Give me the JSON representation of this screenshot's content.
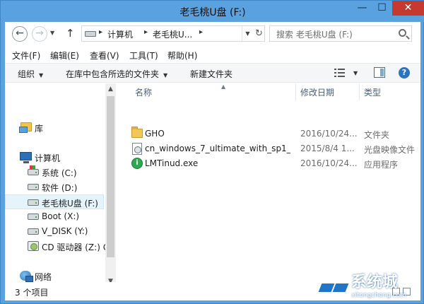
{
  "window": {
    "title": "老毛桃U盘 (F:)",
    "controls": {
      "minimize": "—",
      "maximize": "☐",
      "close": "✕"
    }
  },
  "address": {
    "back": "←",
    "forward": "→",
    "up": "↑",
    "segments": [
      "计算机",
      "老毛桃U..."
    ],
    "refresh": "↻",
    "search_placeholder": "搜索 老毛桃U盘 (F:)"
  },
  "menu": [
    "文件(F)",
    "编辑(E)",
    "查看(V)",
    "工具(T)",
    "帮助(H)"
  ],
  "toolbar": {
    "organize": "组织",
    "include_in_library": "在库中包含所选的文件夹",
    "new_folder": "新建文件夹",
    "help": "?"
  },
  "nav": {
    "library": "库",
    "computer": "计算机",
    "drives": [
      {
        "label": "系统 (C:)",
        "icon": "system-drive-icon"
      },
      {
        "label": "软件 (D:)",
        "icon": "drive-icon"
      },
      {
        "label": "老毛桃U盘 (F:)",
        "icon": "usb-drive-icon",
        "selected": true
      },
      {
        "label": "Boot (X:)",
        "icon": "drive-icon"
      },
      {
        "label": "V_DISK (Y:)",
        "icon": "drive-icon"
      },
      {
        "label": "CD 驱动器 (Z:) G",
        "icon": "cd-drive-icon"
      }
    ],
    "network": "网络"
  },
  "columns": {
    "name": "名称",
    "date": "修改日期",
    "type": "类型"
  },
  "files": [
    {
      "name": "GHO",
      "date": "2016/10/24...",
      "type": "文件夹",
      "icon": "folder-icon"
    },
    {
      "name": "cn_windows_7_ultimate_with_sp1_...",
      "date": "2015/8/4 1...",
      "type": "光盘映像文件",
      "icon": "disc-image-icon"
    },
    {
      "name": "LMTinud.exe",
      "date": "2016/10/24...",
      "type": "应用程序",
      "icon": "exe-icon"
    }
  ],
  "status": {
    "item_count": "3 个项目"
  },
  "watermark": {
    "text": "系统城",
    "url": "xitongcheng.com"
  },
  "colors": {
    "titlebar": "#5aa2df",
    "close": "#c7382f",
    "selection": "#e5f3fb"
  }
}
